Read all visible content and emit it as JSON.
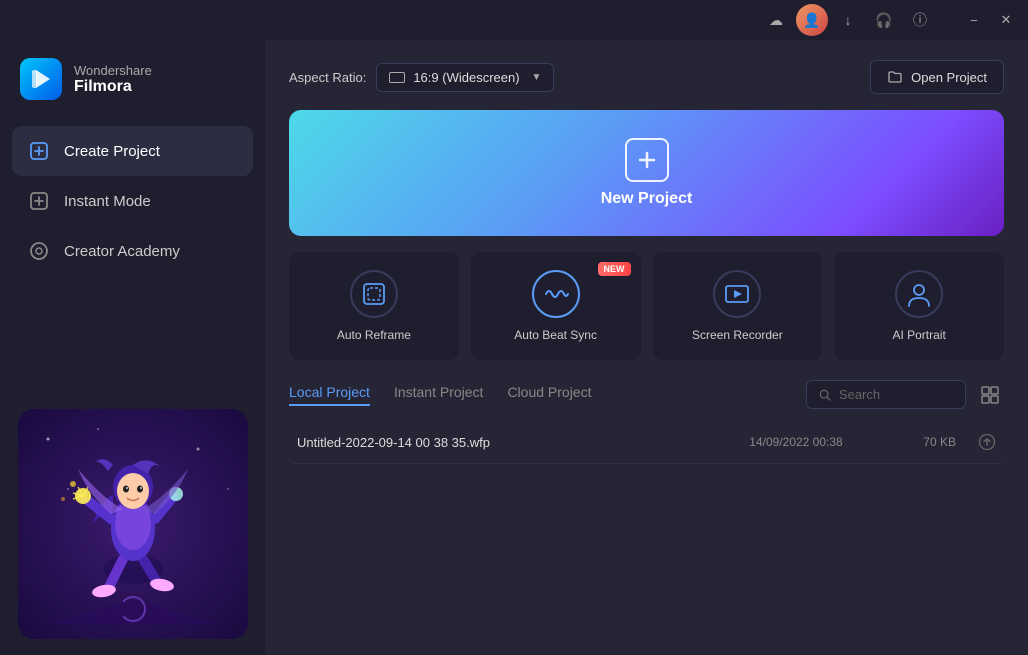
{
  "titlebar": {
    "cloud_icon": "☁",
    "avatar_icon": "👤",
    "download_icon": "↓",
    "headphone_icon": "🎧",
    "info_icon": "ⓘ",
    "minimize_label": "−",
    "close_label": "✕"
  },
  "sidebar": {
    "brand": "Wondershare",
    "product": "Filmora",
    "nav": [
      {
        "id": "create-project",
        "label": "Create Project",
        "icon": "⊞",
        "active": true
      },
      {
        "id": "instant-mode",
        "label": "Instant Mode",
        "icon": "⊕",
        "active": false
      },
      {
        "id": "creator-academy",
        "label": "Creator Academy",
        "icon": "⊙",
        "active": false
      }
    ]
  },
  "topbar": {
    "aspect_ratio_label": "Aspect Ratio:",
    "aspect_value": "16:9 (Widescreen)",
    "open_project_label": "Open Project"
  },
  "new_project": {
    "label": "New Project"
  },
  "feature_cards": [
    {
      "id": "auto-reframe",
      "label": "Auto Reframe",
      "icon": "⊡",
      "new": false
    },
    {
      "id": "auto-beat-sync",
      "label": "Auto Beat Sync",
      "icon": "〜",
      "new": true
    },
    {
      "id": "screen-recorder",
      "label": "Screen Recorder",
      "icon": "⏺",
      "new": false
    },
    {
      "id": "ai-portrait",
      "label": "AI Portrait",
      "icon": "👤",
      "new": false
    }
  ],
  "new_badge_text": "New",
  "projects": {
    "tabs": [
      {
        "id": "local",
        "label": "Local Project",
        "active": true
      },
      {
        "id": "instant",
        "label": "Instant Project",
        "active": false
      },
      {
        "id": "cloud",
        "label": "Cloud Project",
        "active": false
      }
    ],
    "search_placeholder": "Search",
    "rows": [
      {
        "name": "Untitled-2022-09-14 00 38 35.wfp",
        "date": "14/09/2022 00:38",
        "size": "70 KB"
      }
    ]
  }
}
